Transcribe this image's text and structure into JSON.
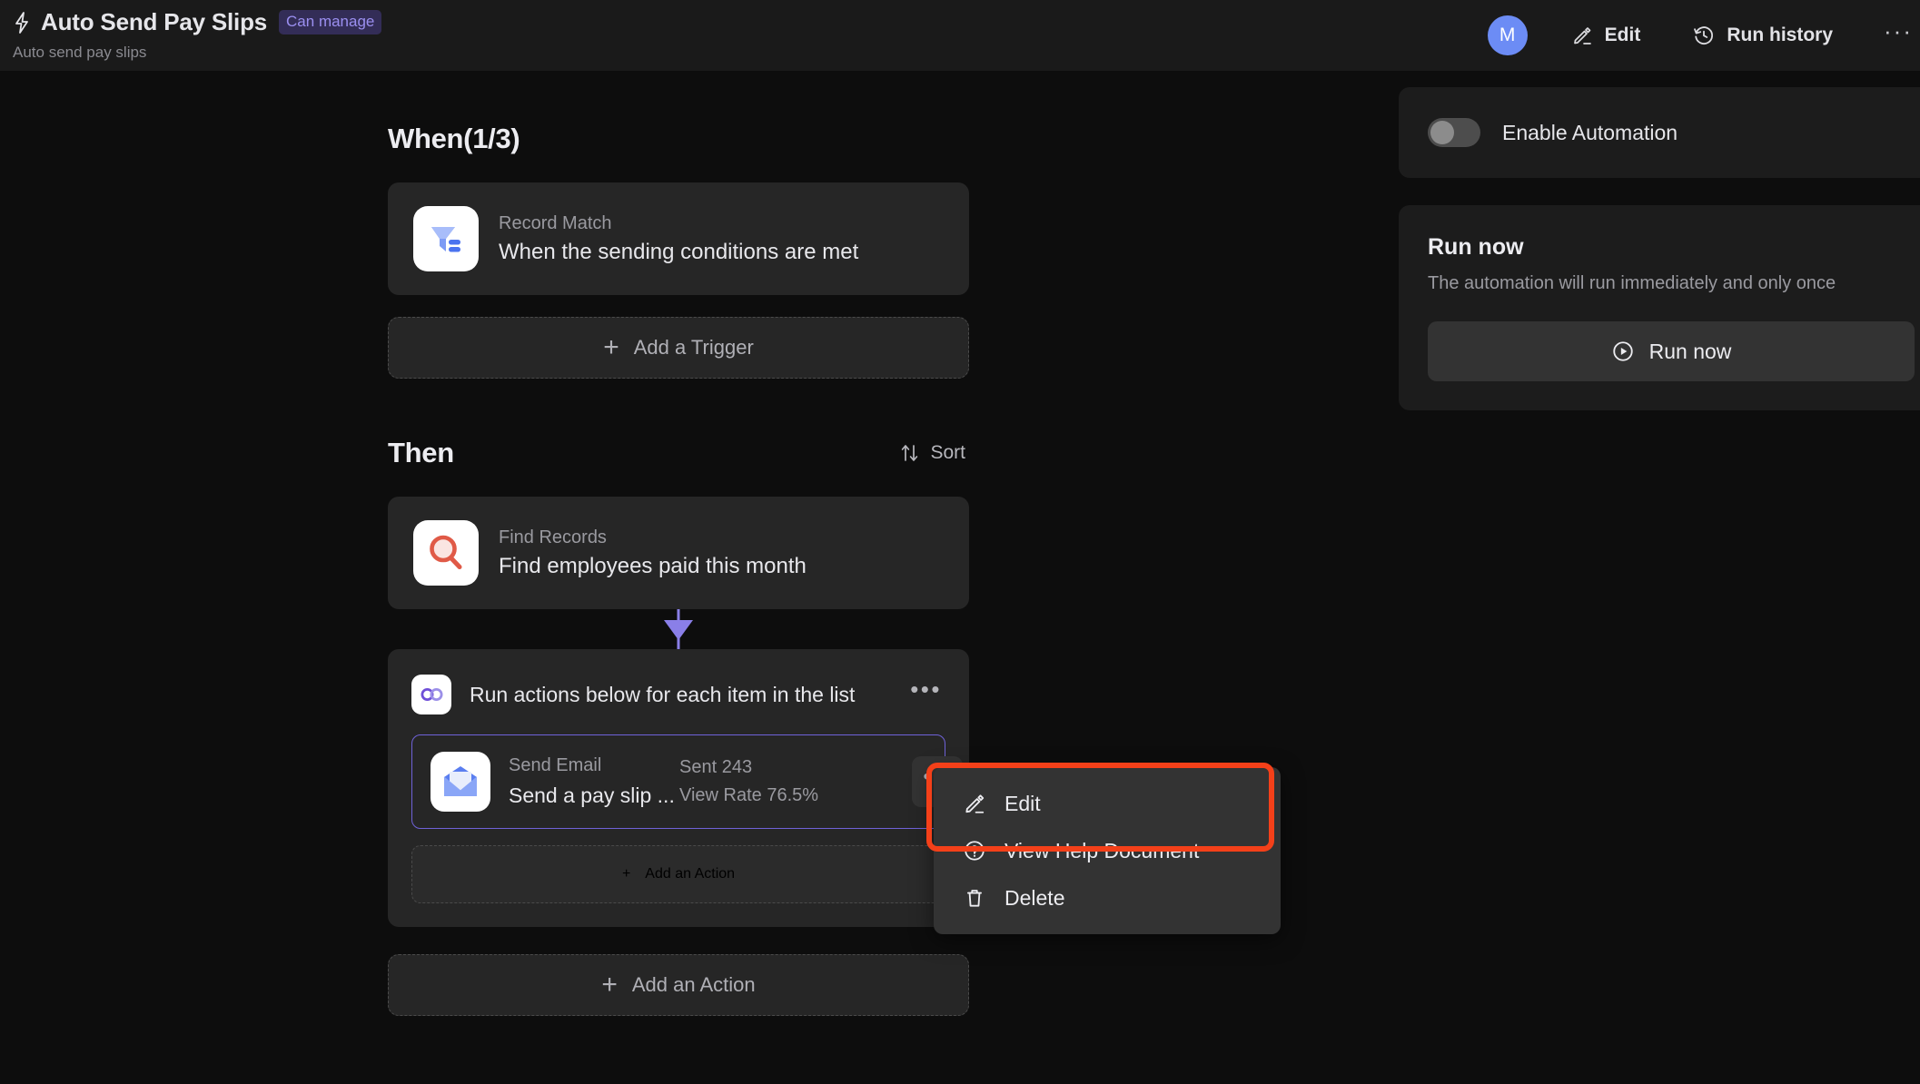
{
  "header": {
    "bolt_icon": "bolt-icon",
    "title": "Auto Send Pay Slips",
    "permission_badge": "Can manage",
    "subtitle": "Auto send pay slips",
    "avatar_initial": "M",
    "edit_label": "Edit",
    "run_history_label": "Run history",
    "more_label": "···"
  },
  "flow": {
    "when": {
      "section_title": "When(1/3)",
      "trigger": {
        "icon": "filter-funnel-icon",
        "type_label": "Record Match",
        "description": "When the sending conditions are met"
      },
      "add_trigger_label": "Add a Trigger"
    },
    "then": {
      "section_title": "Then",
      "sort_label": "Sort",
      "find_records": {
        "icon": "magnifier-icon",
        "type_label": "Find Records",
        "description": "Find employees paid this month"
      },
      "loop": {
        "icon": "infinity-loop-icon",
        "title": "Run actions below for each item in the list",
        "action": {
          "icon": "open-envelope-icon",
          "type_label": "Send Email",
          "description": "Send a pay slip ...",
          "sent_label": "Sent 243",
          "view_rate_label": "View Rate 76.5%"
        },
        "add_action_label": "Add an Action"
      },
      "add_action_label": "Add an Action"
    }
  },
  "context_menu": {
    "items": [
      {
        "icon": "pencil-icon",
        "label": "Edit"
      },
      {
        "icon": "question-circle-icon",
        "label": "View Help Document"
      },
      {
        "icon": "trash-icon",
        "label": "Delete"
      }
    ],
    "highlight_color": "#f44019",
    "highlighted_item": "Edit"
  },
  "right_panel": {
    "enable_automation": {
      "label": "Enable Automation",
      "state": "off"
    },
    "run_now": {
      "title": "Run now",
      "description": "The automation will run immediately and only once",
      "button_label": "Run now"
    }
  },
  "colors": {
    "background": "#0d0d0d",
    "header_bg": "#1a1a1a",
    "card_bg": "#262626",
    "panel_bg": "#1c1c1c",
    "accent_purple": "#8a7fe8",
    "avatar_blue": "#6c8cf5",
    "highlight_red": "#f44019"
  }
}
